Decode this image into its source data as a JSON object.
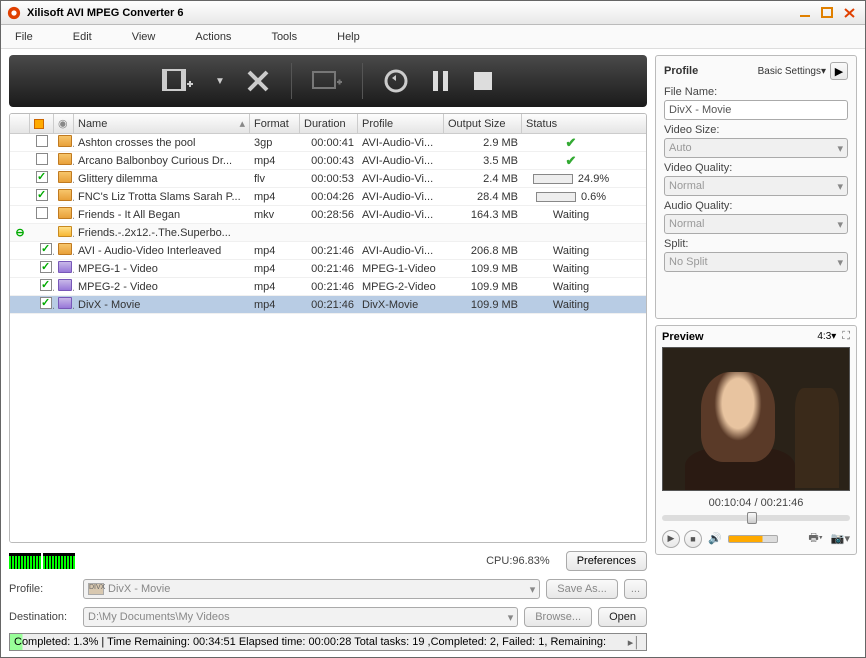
{
  "window": {
    "title": "Xilisoft AVI MPEG Converter 6"
  },
  "menu": [
    "File",
    "Edit",
    "View",
    "Actions",
    "Tools",
    "Help"
  ],
  "columns": [
    "",
    "",
    "",
    "Name",
    "Format",
    "Duration",
    "Profile",
    "Output Size",
    "Status"
  ],
  "rows": [
    {
      "exp": "",
      "chk": false,
      "ico": "file",
      "name": "Ashton crosses the pool",
      "fmt": "3gp",
      "dur": "00:00:41",
      "prof": "AVI-Audio-Vi...",
      "out": "2.9 MB",
      "stat": "done"
    },
    {
      "exp": "",
      "chk": false,
      "ico": "file",
      "name": "Arcano Balbonboy Curious Dr...",
      "fmt": "mp4",
      "dur": "00:00:43",
      "prof": "AVI-Audio-Vi...",
      "out": "3.5 MB",
      "stat": "done"
    },
    {
      "exp": "",
      "chk": true,
      "ico": "file",
      "name": "Glittery dilemma",
      "fmt": "flv",
      "dur": "00:00:53",
      "prof": "AVI-Audio-Vi...",
      "out": "2.4 MB",
      "stat": "progress",
      "pct": "24.9%",
      "pv": 25
    },
    {
      "exp": "",
      "chk": true,
      "ico": "file",
      "name": "FNC's Liz Trotta Slams Sarah P...",
      "fmt": "mp4",
      "dur": "00:04:26",
      "prof": "AVI-Audio-Vi...",
      "out": "28.4 MB",
      "stat": "progress",
      "pct": "0.6%",
      "pv": 1
    },
    {
      "exp": "",
      "chk": false,
      "ico": "file",
      "name": "Friends - It All Began",
      "fmt": "mkv",
      "dur": "00:28:56",
      "prof": "AVI-Audio-Vi...",
      "out": "164.3 MB",
      "stat": "Waiting"
    },
    {
      "exp": "⊖",
      "chk": "",
      "ico": "folder",
      "name": "Friends.-.2x12.-.The.Superbo...",
      "fmt": "",
      "dur": "",
      "prof": "",
      "out": "",
      "stat": "",
      "folder": true
    },
    {
      "exp": "",
      "chk": true,
      "ico": "file",
      "name": "AVI - Audio-Video Interleaved",
      "fmt": "mp4",
      "dur": "00:21:46",
      "prof": "AVI-Audio-Vi...",
      "out": "206.8 MB",
      "stat": "Waiting",
      "indent": true
    },
    {
      "exp": "",
      "chk": true,
      "ico": "purple",
      "name": "MPEG-1 - Video",
      "fmt": "mp4",
      "dur": "00:21:46",
      "prof": "MPEG-1-Video",
      "out": "109.9 MB",
      "stat": "Waiting",
      "indent": true
    },
    {
      "exp": "",
      "chk": true,
      "ico": "purple",
      "name": "MPEG-2 - Video",
      "fmt": "mp4",
      "dur": "00:21:46",
      "prof": "MPEG-2-Video",
      "out": "109.9 MB",
      "stat": "Waiting",
      "indent": true
    },
    {
      "exp": "",
      "chk": true,
      "ico": "purple",
      "name": "DivX - Movie",
      "fmt": "mp4",
      "dur": "00:21:46",
      "prof": "DivX-Movie",
      "out": "109.9 MB",
      "stat": "Waiting",
      "indent": true,
      "selected": true
    }
  ],
  "cpu": {
    "label": "CPU:96.83%"
  },
  "preferences": "Preferences",
  "profile_row": {
    "label": "Profile:",
    "value": "DivX - Movie",
    "saveas": "Save As...",
    "saveas_icon": "..."
  },
  "dest_row": {
    "label": "Destination:",
    "value": "D:\\My Documents\\My Videos",
    "browse": "Browse...",
    "open": "Open"
  },
  "status_text": "Completed: 1.3% | Time Remaining: 00:34:51 Elapsed time: 00:00:28 Total tasks: 19 ,Completed: 2, Failed: 1, Remaining:",
  "side": {
    "title": "Profile",
    "basic": "Basic Settings▾",
    "filename_lbl": "File Name:",
    "filename_val": "DivX - Movie",
    "videosize_lbl": "Video Size:",
    "videosize_val": "Auto",
    "videoq_lbl": "Video Quality:",
    "videoq_val": "Normal",
    "audioq_lbl": "Audio Quality:",
    "audioq_val": "Normal",
    "split_lbl": "Split:",
    "split_val": "No Split"
  },
  "preview": {
    "title": "Preview",
    "aspect": "4:3▾",
    "time": "00:10:04 / 00:21:46"
  }
}
